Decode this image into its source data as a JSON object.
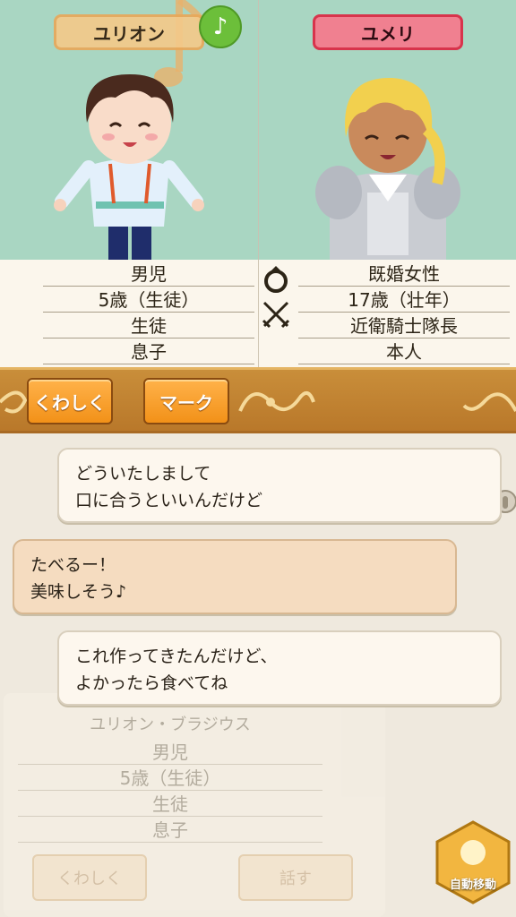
{
  "left_character": {
    "name": "ユリオン",
    "info": [
      "男児",
      "5歳（生徒）",
      "生徒",
      "息子"
    ]
  },
  "right_character": {
    "name": "ユメリ",
    "info": [
      "既婚女性",
      "17歳（壮年）",
      "近衛騎士隊長",
      "本人"
    ]
  },
  "toolbar": {
    "details_label": "くわしく",
    "mark_label": "マーク"
  },
  "chat": {
    "messages": [
      {
        "line1": "どういたしまして",
        "line2": "口に合うといいんだけど"
      },
      {
        "line1": "たべるー！",
        "line2": "美味しそう♪"
      },
      {
        "line1": "これ作ってきたんだけど、",
        "line2": "よかったら食べてね"
      }
    ]
  },
  "background_panel": {
    "title": "ユリオン・ブラジウス",
    "rows": [
      "男児",
      "5歳（生徒）",
      "生徒",
      "息子"
    ],
    "details_label": "くわしく",
    "talk_label": "話す"
  },
  "auto_move_label": "自動移動",
  "icons": {
    "music": "music-note-icon",
    "ring": "ring-icon",
    "swords": "crossed-swords-icon"
  },
  "colors": {
    "panel_bg": "#a9d6c2",
    "orange_button": "#f29118",
    "pink_tag": "#f08090",
    "music_green": "#6cbf3a"
  }
}
